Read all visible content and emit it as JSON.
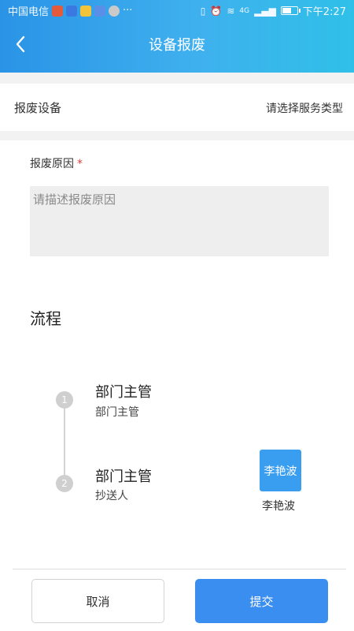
{
  "status_bar": {
    "carrier": "中国电信",
    "more": "···",
    "network": "4G",
    "time": "下午2:27"
  },
  "header": {
    "title": "设备报废",
    "back_icon": "chevron-left-icon"
  },
  "device": {
    "label": "报废设备",
    "value": "请选择服务类型"
  },
  "reason": {
    "label": "报废原因",
    "required_mark": "*",
    "placeholder": "请描述报废原因",
    "value": ""
  },
  "flow": {
    "title": "流程",
    "steps": [
      {
        "number": "1",
        "name": "部门主管",
        "role": "部门主管"
      },
      {
        "number": "2",
        "name": "部门主管",
        "role": "抄送人",
        "assignee": {
          "avatar_text": "李艳波",
          "name": "李艳波"
        }
      }
    ]
  },
  "actions": {
    "cancel_label": "取消",
    "submit_label": "提交"
  },
  "colors": {
    "header_start": "#2a93e6",
    "header_end": "#2fc0e8",
    "primary": "#3a8ef0",
    "avatar": "#3a9ef0",
    "required": "#e23b3b"
  }
}
